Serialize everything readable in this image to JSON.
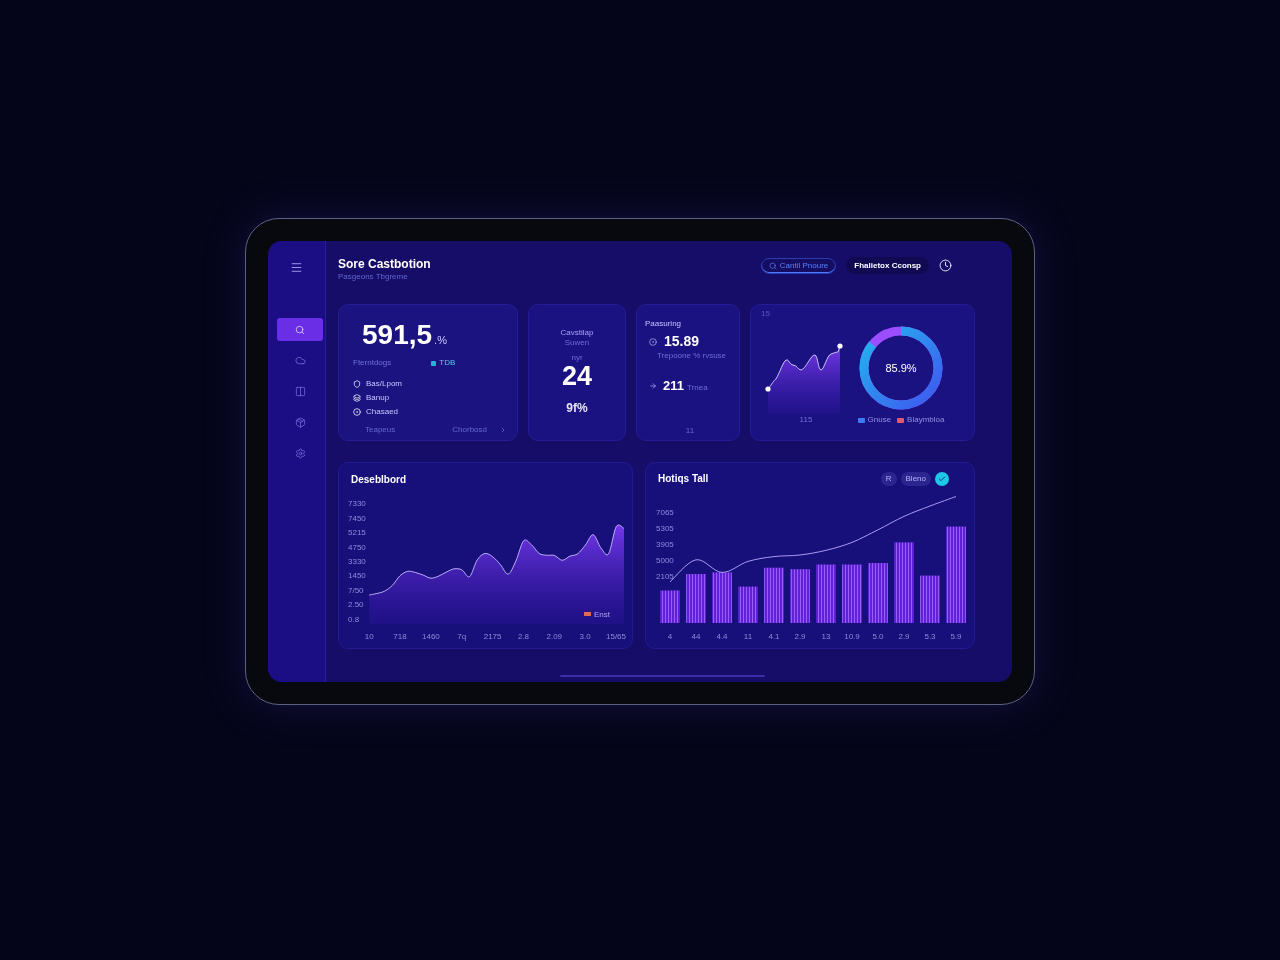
{
  "sidebar": {
    "items": [
      {
        "selected": true
      },
      {
        "selected": false
      },
      {
        "selected": false
      },
      {
        "selected": false
      },
      {
        "selected": false
      }
    ]
  },
  "header": {
    "title": "Sore Castbotion",
    "subtitle": "Pasgeons Tbgreme",
    "search_pill": "Cantil Pnoure",
    "button": "Fhalietox Cconsp"
  },
  "total_card": {
    "value": "591,5",
    "unit": ".%",
    "label": "Fterntdogs",
    "legend": {
      "label": "TDB",
      "color": "#22b5d6"
    },
    "items": [
      "Bas/Lpom",
      "Banup",
      "Chasaed"
    ],
    "footer": {
      "left": "Teapeus",
      "right": "Chorbosd"
    }
  },
  "count_card": {
    "title": "Cavstilap",
    "subtitle": "Suwen",
    "caption": "nyr",
    "value": "24",
    "change": "9f%"
  },
  "metrics_card": {
    "title": "Paasuring",
    "rows": [
      {
        "kind": "stacked",
        "value": "15.89",
        "note": "Trepoone % rvsuse"
      },
      {
        "kind": "inline",
        "value": "211",
        "note": "Trnea"
      }
    ],
    "footer": "11"
  },
  "summary_card": {
    "label": "15",
    "sparkline_label": "115",
    "gauge": {
      "level": 0.859,
      "reading": "85.9%"
    },
    "legend": [
      {
        "label": "Gnuse",
        "color": "#3b7cf6"
      },
      {
        "label": "Blaymbloa",
        "color": "#e8566a"
      }
    ]
  },
  "trend_chart": {
    "title": "Deseblbord",
    "legend": [
      {
        "label": "Enst",
        "color": "#e0694f"
      }
    ],
    "y_axis_labels": [
      "7330",
      "7450",
      "5215",
      "4750",
      "3330",
      "1450",
      "7/50",
      "2.50",
      "0.8"
    ],
    "x_axis_labels": [
      "10",
      "718",
      "1460",
      "7q",
      "2175",
      "2.8",
      "2.09",
      "3.0",
      "15/65"
    ]
  },
  "bar_chart": {
    "title": "Hotiqs Tall",
    "actions": [
      "R",
      "Bleno"
    ],
    "y_axis_labels": [
      "7065",
      "5305",
      "3905",
      "5000",
      "2105"
    ],
    "x_axis_labels": [
      "4",
      "44",
      "4.4",
      "11",
      "4.1",
      "2.9",
      "13",
      "10.9",
      "5.0",
      "2.9",
      "5.3",
      "5.9"
    ]
  }
}
